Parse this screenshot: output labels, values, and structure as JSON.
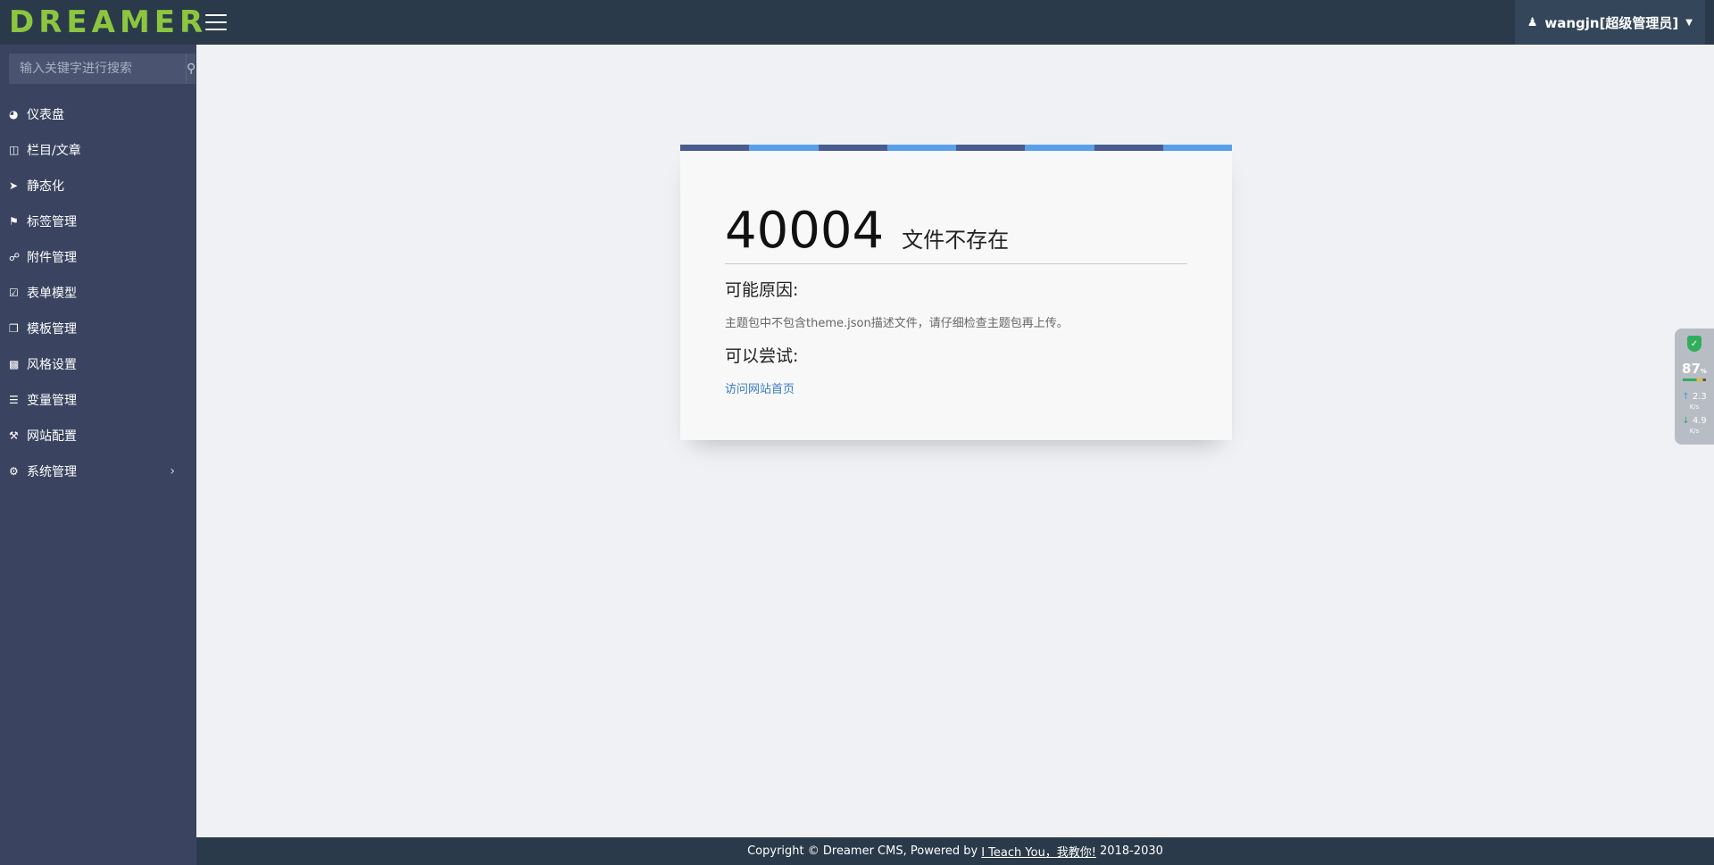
{
  "header": {
    "logo_text": "DREAMER",
    "user_label": "wangjn[超级管理员]"
  },
  "sidebar": {
    "search_placeholder": "输入关键字进行搜索",
    "items": [
      {
        "label": "仪表盘",
        "icon": "dashboard-icon"
      },
      {
        "label": "栏目/文章",
        "icon": "columns-icon"
      },
      {
        "label": "静态化",
        "icon": "rocket-icon"
      },
      {
        "label": "标签管理",
        "icon": "tags-icon"
      },
      {
        "label": "附件管理",
        "icon": "link-icon"
      },
      {
        "label": "表单模型",
        "icon": "check-square-icon"
      },
      {
        "label": "模板管理",
        "icon": "copy-icon"
      },
      {
        "label": "风格设置",
        "icon": "puzzle-icon"
      },
      {
        "label": "变量管理",
        "icon": "list-icon"
      },
      {
        "label": "网站配置",
        "icon": "wrench-icon"
      },
      {
        "label": "系统管理",
        "icon": "gear-icon"
      }
    ]
  },
  "error": {
    "code": "40004",
    "message": "文件不存在",
    "reason_title": "可能原因:",
    "reason_text": "主题包中不包含theme.json描述文件，请仔细检查主题包再上传。",
    "try_title": "可以尝试:",
    "try_link": "访问网站首页"
  },
  "footer": {
    "prefix": "Copyright © Dreamer CMS, Powered by",
    "link": "I Teach You，我教你!",
    "suffix": "2018-2030"
  },
  "widget": {
    "percent": "87",
    "percent_unit": "%",
    "upload": "2.3",
    "download": "4.9",
    "speed_unit": "K/s"
  },
  "colors": {
    "header_bg": "#2a3a4a",
    "sidebar_bg": "#3a4460",
    "logo": "#8cc63f",
    "stripe_dark": "#4a5c8e",
    "stripe_light": "#5aa0e8",
    "link": "#3a7ac4"
  }
}
